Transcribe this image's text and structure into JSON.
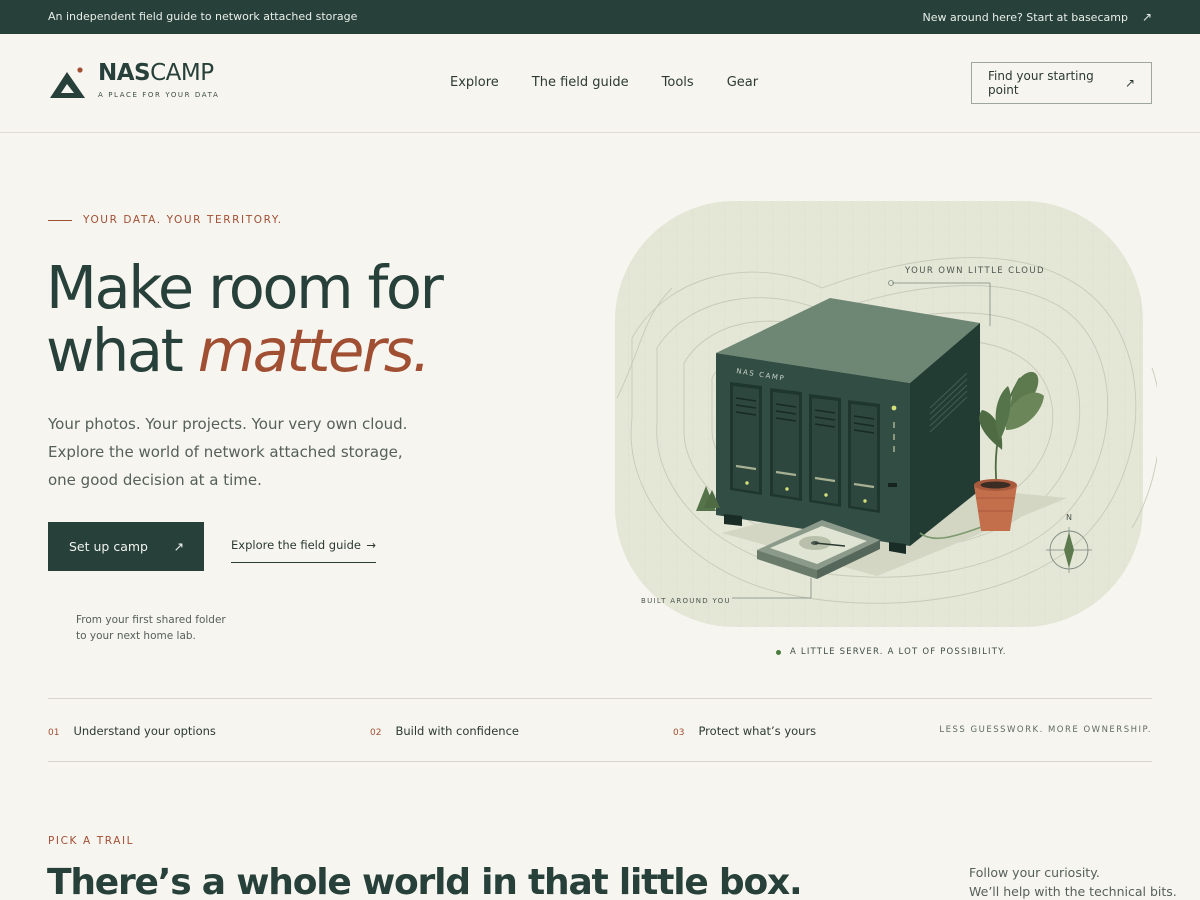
{
  "topbar": {
    "left_text": "An independent field guide to network attached storage",
    "right_text": "New around here? Start at basecamp",
    "right_icon": "arrow-up-right-icon"
  },
  "brand": {
    "name_bold": "NAS",
    "name_light": "CAMP",
    "tagline": "A PLACE FOR YOUR DATA",
    "logo_icon": "tent-mountain-icon"
  },
  "nav": {
    "items": [
      "Explore",
      "The field guide",
      "Tools",
      "Gear"
    ]
  },
  "header_cta": {
    "label": "Find your starting point",
    "icon": "arrow-up-right-icon"
  },
  "hero": {
    "eyebrow": "YOUR DATA. YOUR TERRITORY.",
    "headline_line1": "Make room for",
    "headline_line2_plain": "what ",
    "headline_line2_accent": "matters.",
    "lede": "Your photos. Your projects. Your very own cloud. Explore the world of network attached storage, one good decision at a time.",
    "primary_button": "Set up camp",
    "secondary_link": "Explore the field guide",
    "note_line1": "From your first shared folder",
    "note_line2": "to your next home lab."
  },
  "illustration": {
    "label_top": "YOUR OWN LITTLE CLOUD",
    "label_bottom": "BUILT AROUND YOU",
    "device_brand": "NAS CAMP",
    "compass_letter": "N",
    "caption": "A LITTLE SERVER. A LOT OF POSSIBILITY."
  },
  "steps": {
    "items": [
      {
        "num": "01",
        "label": "Understand your options"
      },
      {
        "num": "02",
        "label": "Build with confidence"
      },
      {
        "num": "03",
        "label": "Protect what’s yours"
      }
    ],
    "tag": "LESS GUESSWORK. MORE OWNERSHIP."
  },
  "trails": {
    "eyebrow": "PICK A TRAIL",
    "title": "There’s a whole world in that little box.",
    "side_line1": "Follow your curiosity.",
    "side_line2": "We’ll help with the technical bits."
  },
  "colors": {
    "forest": "#27403a",
    "rust": "#a14f33",
    "paper": "#f7f5f0",
    "sage": "#e4e6d6"
  }
}
